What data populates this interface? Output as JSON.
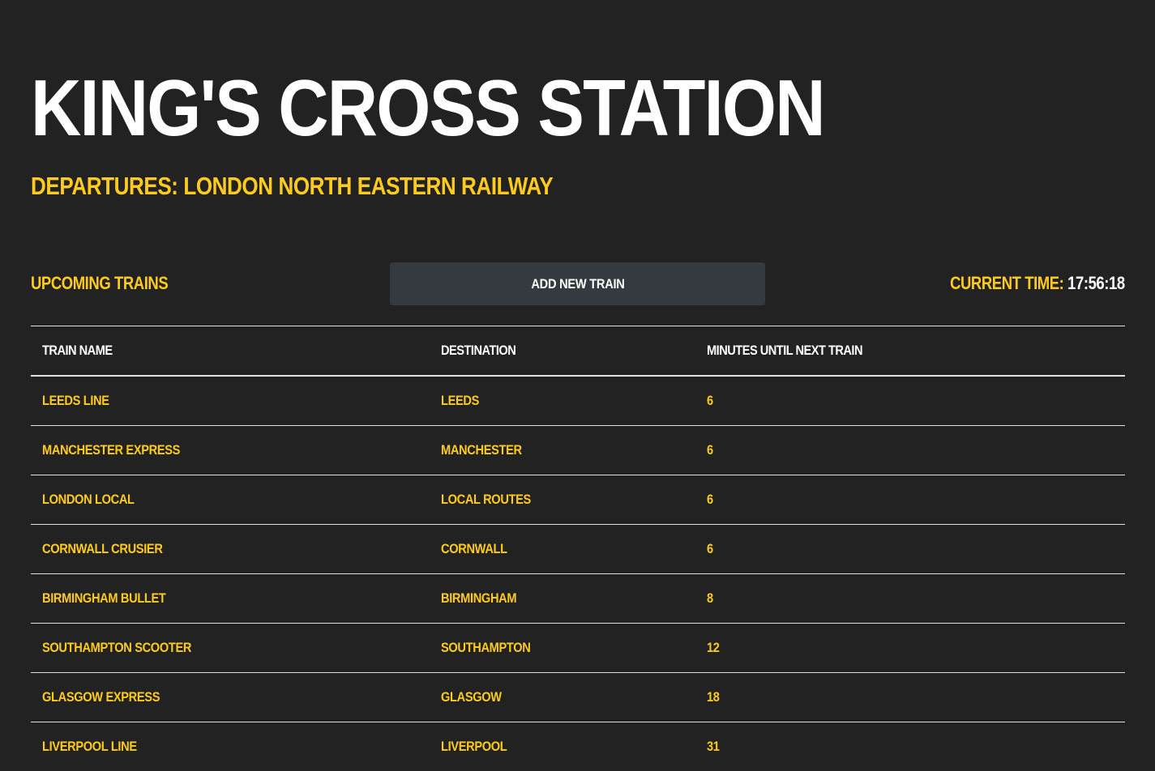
{
  "header": {
    "title": "King's Cross Station",
    "subtitle": "Departures: London North Eastern Railway"
  },
  "toolbar": {
    "section_label": "Upcoming Trains",
    "add_button_label": "Add New Train",
    "clock_label": "Current Time:",
    "clock_value": "17:56:18"
  },
  "table": {
    "columns": [
      "Train Name",
      "Destination",
      "Minutes Until Next Train"
    ],
    "rows": [
      {
        "name": "Leeds Line",
        "destination": "Leeds",
        "minutes": "6"
      },
      {
        "name": "Manchester Express",
        "destination": "Manchester",
        "minutes": "6"
      },
      {
        "name": "London Local",
        "destination": "Local Routes",
        "minutes": "6"
      },
      {
        "name": "Cornwall Crusier",
        "destination": "Cornwall",
        "minutes": "6"
      },
      {
        "name": "Birmingham Bullet",
        "destination": "Birmingham",
        "minutes": "8"
      },
      {
        "name": "Southampton Scooter",
        "destination": "Southampton",
        "minutes": "12"
      },
      {
        "name": "Glasgow Express",
        "destination": "Glasgow",
        "minutes": "18"
      },
      {
        "name": "Liverpool Line",
        "destination": "Liverpool",
        "minutes": "31"
      }
    ]
  },
  "colors": {
    "background": "#222222",
    "accent": "#ffcb1f",
    "button": "#343a40",
    "text": "#ffffff",
    "rule": "#dee2e6"
  }
}
